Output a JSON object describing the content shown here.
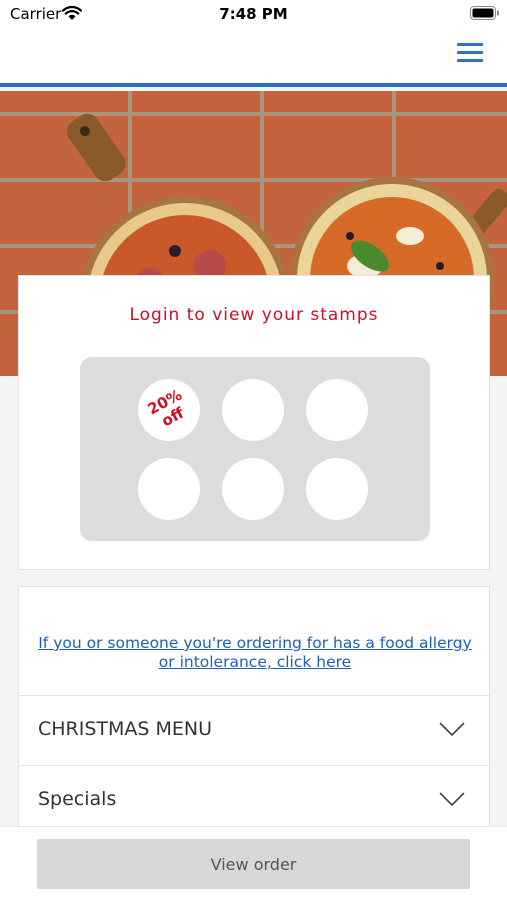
{
  "status_bar": {
    "carrier": "Carrier",
    "time": "7:48 PM",
    "icons": [
      "wifi-icon",
      "battery-icon"
    ]
  },
  "nav": {
    "menu_icon": "hamburger-menu-icon",
    "accent_color": "#2f6fc0"
  },
  "hero": {
    "image": "pizzas-on-terracotta-tiles"
  },
  "stamp_card": {
    "title": "Login to view your stamps",
    "reward_label": "20% off",
    "stamp_count": 6,
    "title_color": "#c8102e"
  },
  "menu": {
    "allergy_link": "If you or someone you're ordering for has a food allergy or intolerance, click here",
    "categories": [
      {
        "label": "CHRISTMAS MENU",
        "icon": "chevron-down-icon"
      },
      {
        "label": "Specials",
        "icon": "chevron-down-icon"
      }
    ]
  },
  "footer": {
    "view_order_label": "View order"
  }
}
